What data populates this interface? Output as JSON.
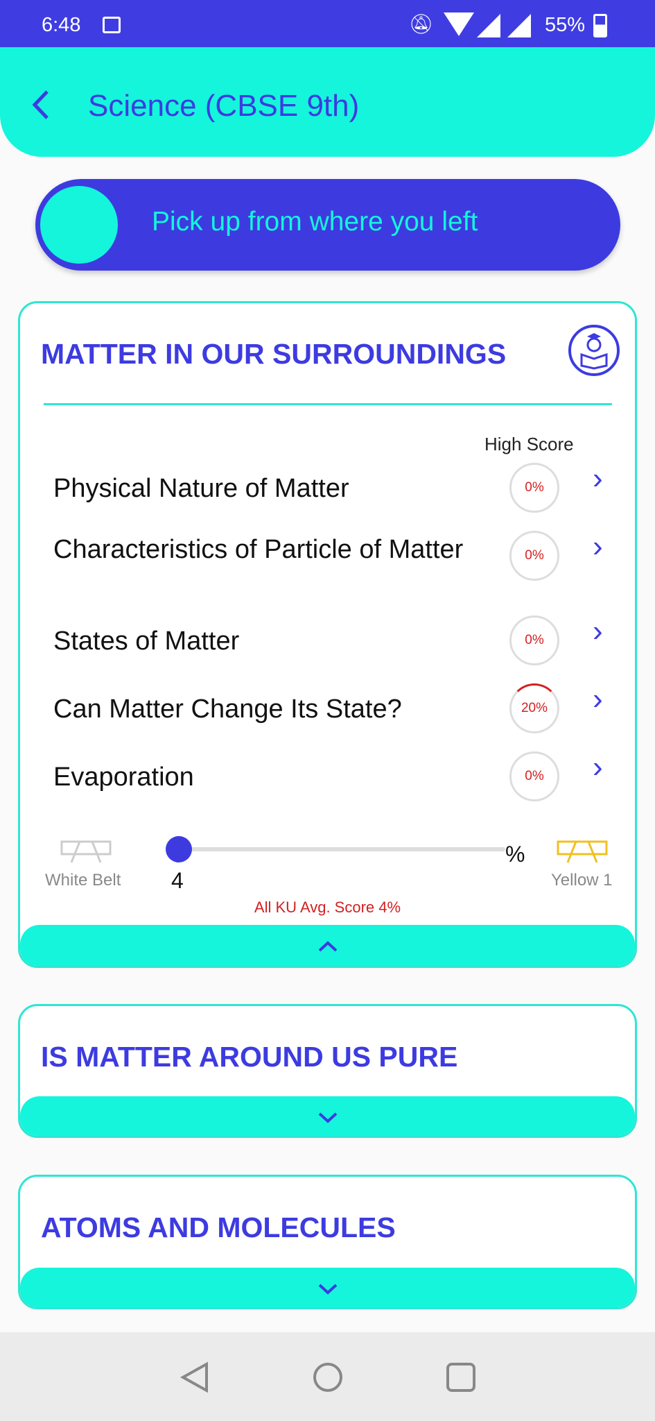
{
  "status_bar": {
    "time": "6:48",
    "battery": "55%"
  },
  "header": {
    "title": "Science (CBSE 9th)"
  },
  "resume_button": {
    "label": "Pick up from where you left"
  },
  "chapters": [
    {
      "title": "MATTER IN OUR SURROUNDINGS",
      "expanded": true,
      "high_score_label": "High Score",
      "topics": [
        {
          "name": "Physical Nature of Matter",
          "score": "0%",
          "value": 0
        },
        {
          "name": "Characteristics of Particle of Matter",
          "score": "0%",
          "value": 0
        },
        {
          "name": "States of Matter",
          "score": "0%",
          "value": 0
        },
        {
          "name": "Can Matter Change Its State?",
          "score": "20%",
          "value": 20
        },
        {
          "name": "Evaporation",
          "score": "0%",
          "value": 0
        }
      ],
      "progress": {
        "current_belt": "White Belt",
        "next_belt": "Yellow 1",
        "value": "4",
        "unit": "%",
        "avg_score": "All KU Avg. Score 4%"
      }
    },
    {
      "title": "IS MATTER AROUND US PURE",
      "expanded": false
    },
    {
      "title": "ATOMS AND MOLECULES",
      "expanded": false
    }
  ],
  "colors": {
    "primary": "#3d3be0",
    "accent": "#14f5dc",
    "score": "#d32020",
    "yellow_belt": "#f0c020"
  }
}
